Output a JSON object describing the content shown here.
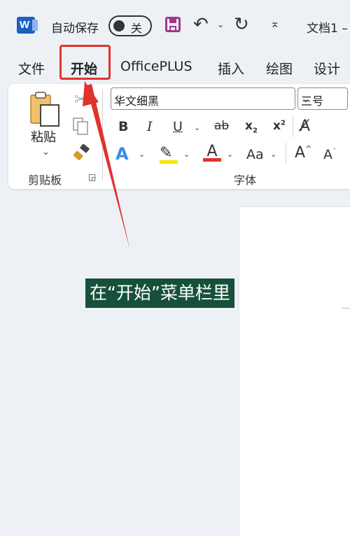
{
  "titlebar": {
    "autosave_label": "自动保存",
    "toggle_state": "关",
    "document_title": "文档1 –"
  },
  "tabs": [
    {
      "label": "文件"
    },
    {
      "label": "开始",
      "active": true
    },
    {
      "label": "OfficePLUS"
    },
    {
      "label": "插入"
    },
    {
      "label": "绘图"
    },
    {
      "label": "设计"
    }
  ],
  "clipboard": {
    "paste_label": "粘贴",
    "group_label": "剪贴板"
  },
  "font": {
    "font_name": "华文细黑",
    "font_size": "三号",
    "group_label": "字体",
    "bold": "B",
    "italic": "I",
    "underline": "U",
    "strikethrough": "ab",
    "subscript": "x",
    "subscript_mark": "2",
    "superscript": "x",
    "superscript_mark": "2",
    "text_effect": "A",
    "highlight": "A",
    "font_color": "A",
    "change_case": "Aa",
    "grow_font": "A",
    "shrink_font": "A",
    "highlight_color": "#f5e600",
    "font_color_value": "#e0322e"
  },
  "annotation": {
    "caption": "在“开始”菜单栏里",
    "highlight_color": "#e0322e",
    "caption_bg": "#16503a"
  }
}
